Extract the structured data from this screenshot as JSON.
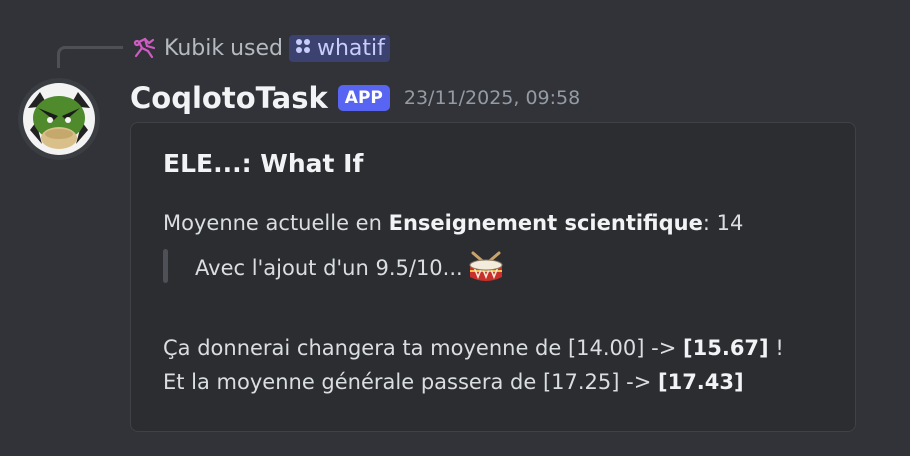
{
  "reply": {
    "user": "Kubik",
    "action": "used",
    "command": "whatif"
  },
  "message": {
    "author": "CoqlotoTask",
    "badge": "APP",
    "timestamp": "23/11/2025, 09:58",
    "embed": {
      "title": "ELE...: What If",
      "line1_prefix": "Moyenne actuelle en",
      "line1_subject": "Enseignement scientifique",
      "line1_suffix": ": 14",
      "quote": "Avec l'ajout d'un 9.5/10...",
      "line2_prefix": "Ça donnerai changera ta moyenne de [14.00] ->",
      "line2_value": "[15.67]",
      "line2_suffix": " !",
      "line3_prefix": "Et la moyenne générale passera de [17.25] ->",
      "line3_value": "[17.43]"
    }
  },
  "icons": {
    "reply_user": "pink-avatar-icon",
    "command": "slash-command-icon",
    "avatar": "green-bird-avatar",
    "emoji": "drum-emoji"
  }
}
